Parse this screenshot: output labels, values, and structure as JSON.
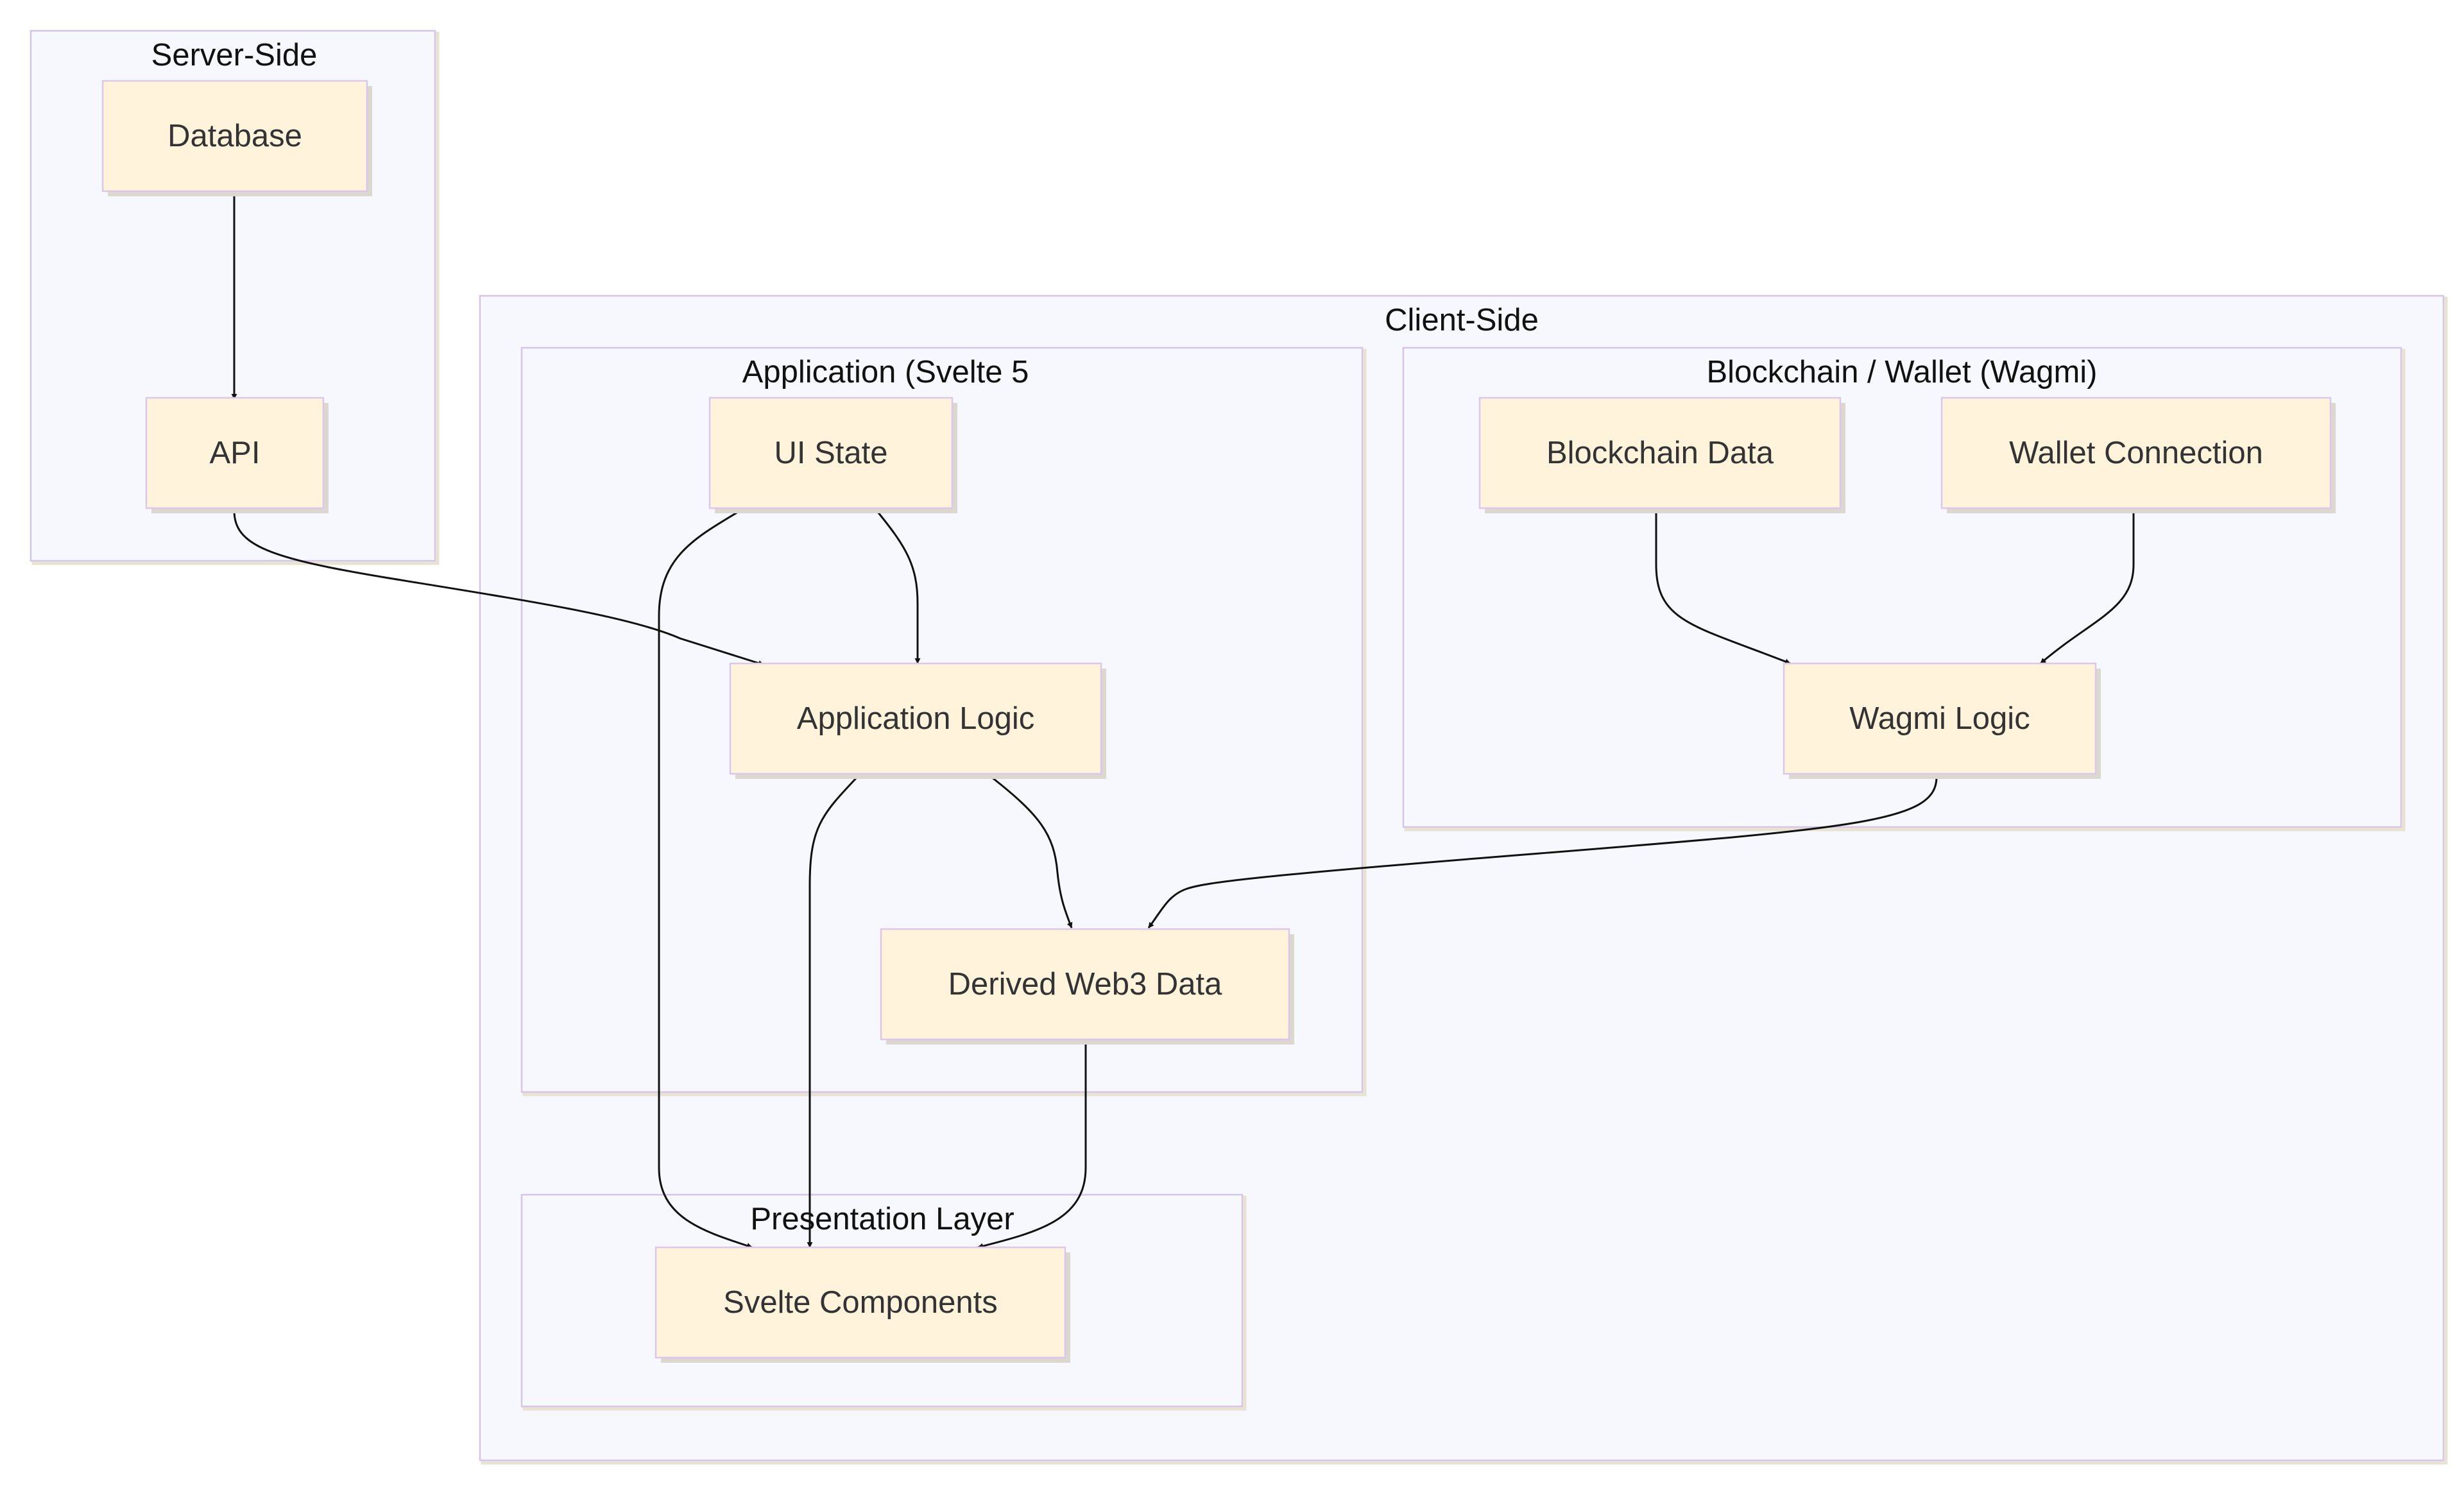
{
  "clusters": {
    "server": {
      "title": "Server-Side"
    },
    "client": {
      "title": "Client-Side"
    },
    "application": {
      "title": "Application (Svelte 5"
    },
    "blockchain": {
      "title": "Blockchain / Wallet (Wagmi)"
    },
    "presentation": {
      "title": "Presentation Layer"
    }
  },
  "nodes": {
    "database": {
      "label": "Database"
    },
    "api": {
      "label": "API"
    },
    "ui_state": {
      "label": "UI State"
    },
    "app_logic": {
      "label": "Application Logic"
    },
    "derived_web3": {
      "label": "Derived Web3 Data"
    },
    "blockchain_data": {
      "label": "Blockchain Data"
    },
    "wallet_connection": {
      "label": "Wallet Connection"
    },
    "wagmi_logic": {
      "label": "Wagmi Logic"
    },
    "svelte_components": {
      "label": "Svelte Components"
    }
  },
  "edges": [
    {
      "from": "database",
      "to": "api",
      "direction": "both"
    },
    {
      "from": "api",
      "to": "app_logic",
      "direction": "both"
    },
    {
      "from": "ui_state",
      "to": "app_logic",
      "direction": "forward"
    },
    {
      "from": "ui_state",
      "to": "svelte_components",
      "direction": "forward"
    },
    {
      "from": "app_logic",
      "to": "derived_web3",
      "direction": "forward"
    },
    {
      "from": "app_logic",
      "to": "svelte_components",
      "direction": "forward"
    },
    {
      "from": "derived_web3",
      "to": "svelte_components",
      "direction": "forward"
    },
    {
      "from": "blockchain_data",
      "to": "wagmi_logic",
      "direction": "forward"
    },
    {
      "from": "wallet_connection",
      "to": "wagmi_logic",
      "direction": "forward"
    },
    {
      "from": "wagmi_logic",
      "to": "derived_web3",
      "direction": "forward"
    }
  ]
}
